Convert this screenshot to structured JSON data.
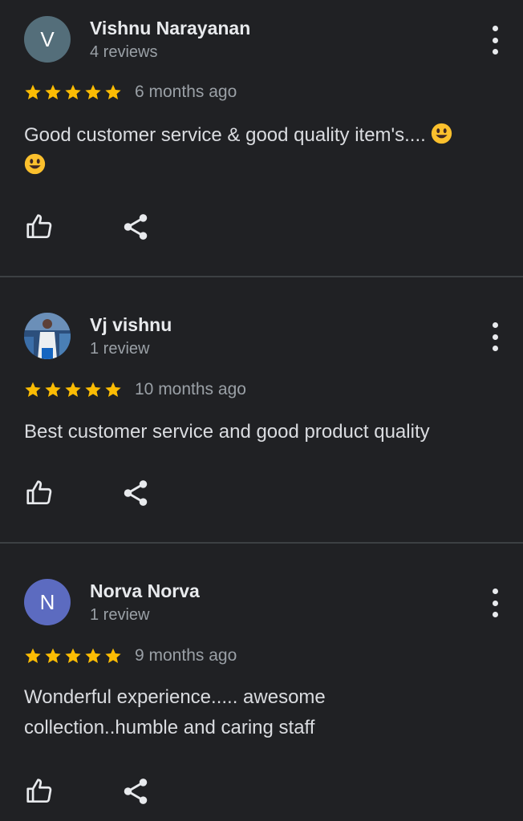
{
  "colors": {
    "background": "#202124",
    "star": "#fbbc04",
    "divider": "#3c4043",
    "avatar_v": "#546e7a",
    "avatar_n": "#5c6bc0"
  },
  "reviews": [
    {
      "avatar_letter": "V",
      "author": "Vishnu Narayanan",
      "review_count": "4 reviews",
      "rating": 5,
      "date": "6 months ago",
      "text": "Good customer service & good quality item's....",
      "emoji": [
        "smiley-emoji",
        "smiley-emoji"
      ]
    },
    {
      "avatar_letter": "",
      "avatar_type": "photo",
      "author": "Vj vishnu",
      "review_count": "1 review",
      "rating": 5,
      "date": "10 months ago",
      "text": "Best customer service and good product quality"
    },
    {
      "avatar_letter": "N",
      "author": "Norva Norva",
      "review_count": "1 review",
      "rating": 5,
      "date": "9 months ago",
      "text": "Wonderful experience..... awesome collection..humble and caring staff"
    }
  ],
  "icons": {
    "more": "more-vert-icon",
    "like": "thumbs-up-icon",
    "share": "share-icon",
    "star": "star-icon"
  }
}
